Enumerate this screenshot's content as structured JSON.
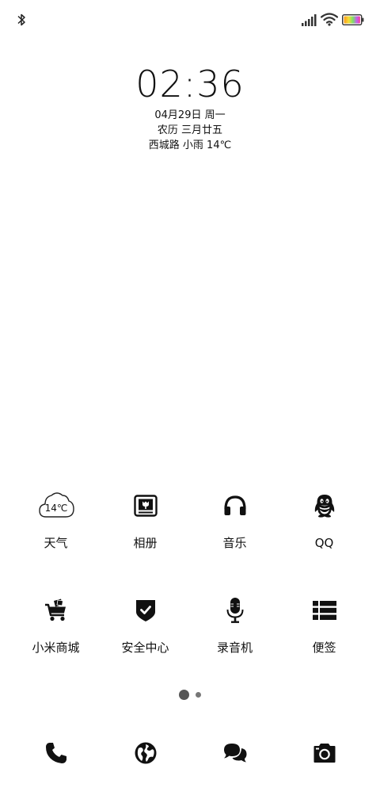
{
  "status_bar": {
    "icons": [
      "bluetooth-icon",
      "signal-icon",
      "wifi-icon",
      "battery-icon"
    ]
  },
  "clock_widget": {
    "time": "02:36",
    "date": "04月29日 周一",
    "lunar": "农历 三月廿五",
    "weather": "西城路 小雨 14℃"
  },
  "apps": [
    {
      "label": "天气",
      "icon": "cloud-weather-icon",
      "icon_text": "14℃"
    },
    {
      "label": "相册",
      "icon": "gallery-icon"
    },
    {
      "label": "音乐",
      "icon": "headphones-icon"
    },
    {
      "label": "QQ",
      "icon": "penguin-icon"
    },
    {
      "label": "小米商城",
      "icon": "shopping-cart-icon"
    },
    {
      "label": "安全中心",
      "icon": "shield-check-icon"
    },
    {
      "label": "录音机",
      "icon": "microphone-icon"
    },
    {
      "label": "便签",
      "icon": "list-notes-icon"
    }
  ],
  "page_indicator": {
    "current": 1,
    "total": 2
  },
  "dock": [
    {
      "icon": "phone-icon"
    },
    {
      "icon": "globe-browser-icon"
    },
    {
      "icon": "chat-bubbles-icon"
    },
    {
      "icon": "camera-icon"
    }
  ]
}
